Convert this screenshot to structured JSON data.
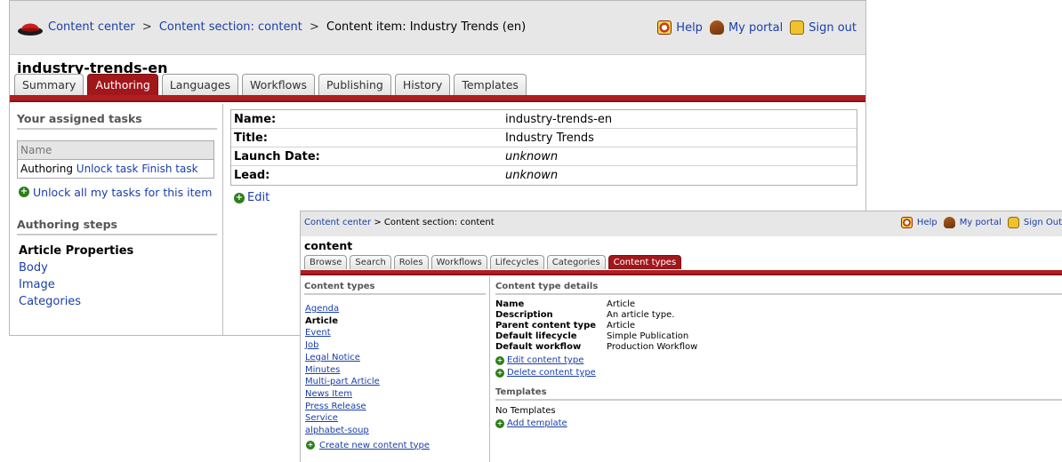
{
  "window1": {
    "breadcrumb": {
      "link1": "Content center",
      "sep1": ">",
      "link2": "Content section: content",
      "sep2": ">",
      "current": "Content item: Industry Trends (en)"
    },
    "topnav": {
      "help": "Help",
      "portal": "My portal",
      "signout": "Sign out"
    },
    "page_title": "industry-trends-en",
    "tabs": [
      {
        "label": "Summary",
        "active": false
      },
      {
        "label": "Authoring",
        "active": true
      },
      {
        "label": "Languages",
        "active": false
      },
      {
        "label": "Workflows",
        "active": false
      },
      {
        "label": "Publishing",
        "active": false
      },
      {
        "label": "History",
        "active": false
      },
      {
        "label": "Templates",
        "active": false
      }
    ],
    "tasks": {
      "heading": "Your assigned tasks",
      "column": "Name",
      "row_label": "Authoring",
      "unlock": "Unlock task",
      "finish": "Finish task",
      "unlock_all": "Unlock all my tasks for this item"
    },
    "steps": {
      "heading": "Authoring steps",
      "items": [
        "Article Properties",
        "Body",
        "Image",
        "Categories"
      ]
    },
    "properties": [
      {
        "key": "Name:",
        "value": "industry-trends-en"
      },
      {
        "key": "Title:",
        "value": "Industry Trends"
      },
      {
        "key": "Launch Date:",
        "value": "unknown"
      },
      {
        "key": "Lead:",
        "value": "unknown"
      }
    ],
    "edit": "Edit"
  },
  "window2": {
    "breadcrumb": {
      "link1": "Content center",
      "sep1": ">",
      "current": "Content section: content"
    },
    "topnav": {
      "help": "Help",
      "portal": "My portal",
      "signout": "Sign Out"
    },
    "page_title": "content",
    "tabs": [
      {
        "label": "Browse",
        "active": false
      },
      {
        "label": "Search",
        "active": false
      },
      {
        "label": "Roles",
        "active": false
      },
      {
        "label": "Workflows",
        "active": false
      },
      {
        "label": "Lifecycles",
        "active": false
      },
      {
        "label": "Categories",
        "active": false
      },
      {
        "label": "Content types",
        "active": true
      }
    ],
    "content_types": {
      "heading": "Content types",
      "items": [
        "Agenda",
        "Article",
        "Event",
        "Job",
        "Legal Notice",
        "Minutes",
        "Multi-part Article",
        "News Item",
        "Press Release",
        "Service",
        "alphabet-soup"
      ],
      "current": "Article",
      "create": "Create new content type"
    },
    "details": {
      "heading": "Content type details",
      "rows": [
        {
          "key": "Name",
          "value": "Article"
        },
        {
          "key": "Description",
          "value": "An article type."
        },
        {
          "key": "Parent content type",
          "value": "Article"
        },
        {
          "key": "Default lifecycle",
          "value": "Simple Publication"
        },
        {
          "key": "Default workflow",
          "value": "Production Workflow"
        }
      ],
      "edit": "Edit content type",
      "delete": "Delete content type"
    },
    "templates": {
      "heading": "Templates",
      "empty": "No Templates",
      "add": "Add template"
    }
  },
  "colors": {
    "accent_red": "#a1171c",
    "link_blue": "#1a3fa8",
    "header_gray": "#e7e7e7",
    "add_green": "#2e7d1a"
  }
}
